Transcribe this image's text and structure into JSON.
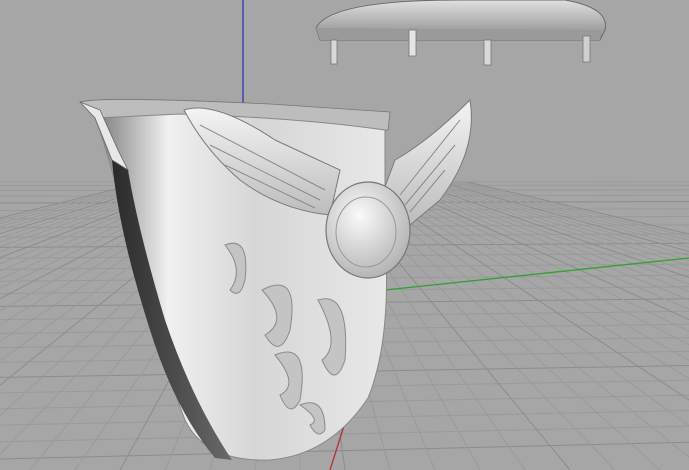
{
  "viewport": {
    "view": "perspective",
    "background_color": "#a6a6a6",
    "grid_color": "#9a9a9a",
    "grid_major_color": "#8c8c8c",
    "axis_x_color": "#b43232",
    "axis_y_color": "#32a032",
    "axis_z_color": "#3232b4"
  },
  "scene": {
    "objects": [
      {
        "name": "signet-ring",
        "material": "gray-clay",
        "ornaments": [
          "winged-emblem",
          "flame-engraving"
        ]
      },
      {
        "name": "stone-setting-cap",
        "material": "gray-clay",
        "prongs": 4
      }
    ]
  }
}
